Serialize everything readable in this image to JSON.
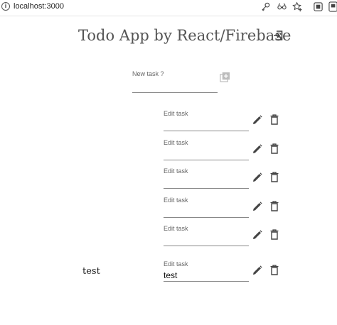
{
  "browser": {
    "url": "localhost:3000",
    "icons": [
      "info-icon",
      "key-icon",
      "reading-mode-icon",
      "favorite-icon",
      "collections-icon",
      "profile-icon"
    ]
  },
  "header": {
    "title": "Todo App by React/Firebase",
    "logout_icon": "logout-icon"
  },
  "new_task": {
    "label": "New task ?",
    "value": "",
    "add_icon": "add-box-icon"
  },
  "tasks": [
    {
      "name": "",
      "edit_label": "Edit task",
      "edit_value": ""
    },
    {
      "name": "",
      "edit_label": "Edit task",
      "edit_value": ""
    },
    {
      "name": "",
      "edit_label": "Edit task",
      "edit_value": ""
    },
    {
      "name": "",
      "edit_label": "Edit task",
      "edit_value": ""
    },
    {
      "name": "",
      "edit_label": "Edit task",
      "edit_value": ""
    },
    {
      "name": "test",
      "edit_label": "Edit task",
      "edit_value": "test"
    }
  ],
  "colors": {
    "icon": "#444444",
    "add_icon": "#bdbdbd",
    "underline": "#888888",
    "title": "#555555"
  }
}
